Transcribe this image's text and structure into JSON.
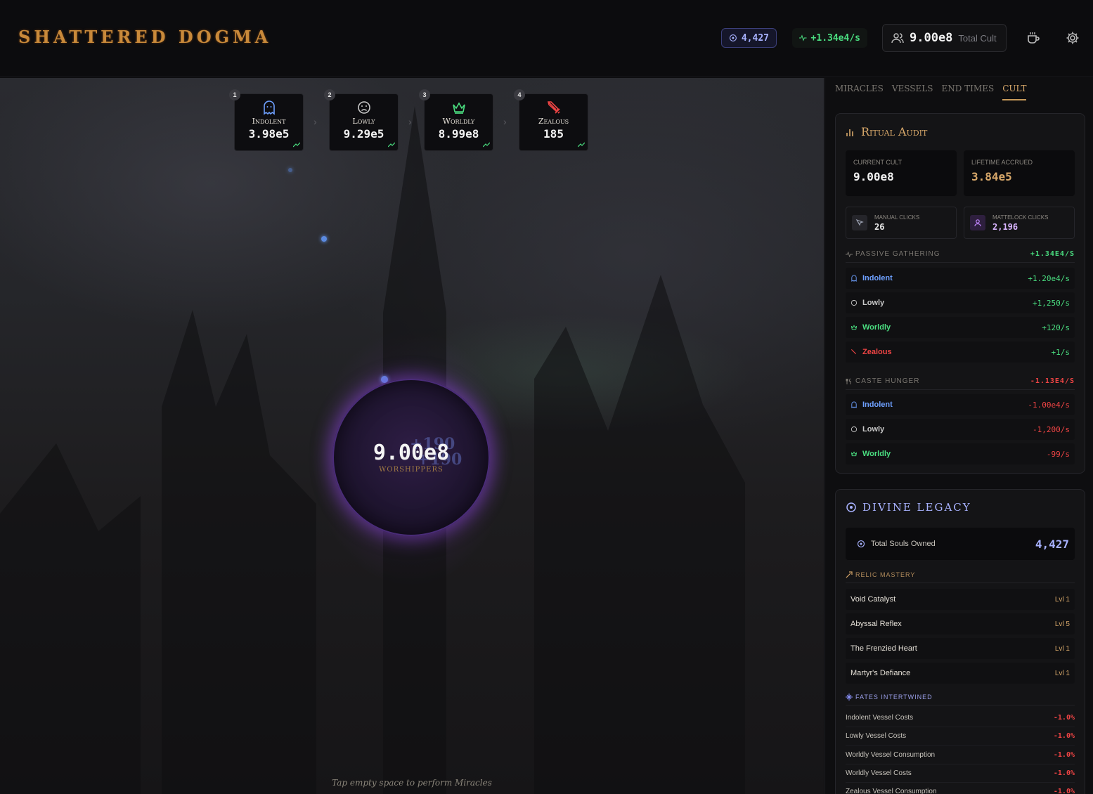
{
  "header": {
    "logo": "SHATTERED DOGMA",
    "souls": "4,427",
    "rate": "+1.34e4/s",
    "total_cult_value": "9.00e8",
    "total_cult_label": "Total Cult"
  },
  "castes": [
    {
      "num": "1",
      "name": "Indolent",
      "value": "3.98e5",
      "color": "#6ea0ff",
      "icon": "ghost-icon"
    },
    {
      "num": "2",
      "name": "Lowly",
      "value": "9.29e5",
      "color": "#b8b8b8",
      "icon": "frown-icon"
    },
    {
      "num": "3",
      "name": "Worldly",
      "value": "8.99e8",
      "color": "#4ade80",
      "icon": "crown-icon"
    },
    {
      "num": "4",
      "name": "Zealous",
      "value": "185",
      "color": "#ef4444",
      "icon": "sword-icon"
    }
  ],
  "orb": {
    "value": "9.00e8",
    "label": "WORSHIPPERS",
    "ghost_a": "+190",
    "ghost_b": "+190"
  },
  "hint": "Tap empty space to perform Miracles",
  "tabs": [
    "MIRACLES",
    "VESSELS",
    "END TIMES",
    "CULT"
  ],
  "active_tab": "CULT",
  "ritual_audit": {
    "title": "Ritual Audit",
    "current_cult_label": "CURRENT CULT",
    "current_cult_value": "9.00e8",
    "lifetime_label": "LIFETIME ACCRUED",
    "lifetime_value": "3.84e5",
    "manual_clicks_label": "MANUAL CLICKS",
    "manual_clicks_value": "26",
    "mattelock_label": "MATTELOCK CLICKS",
    "mattelock_value": "2,196",
    "passive_label": "PASSIVE GATHERING",
    "passive_total": "+1.34E4/S",
    "passive_rows": [
      {
        "name": "Indolent",
        "value": "+1.20e4/s"
      },
      {
        "name": "Lowly",
        "value": "+1,250/s"
      },
      {
        "name": "Worldly",
        "value": "+120/s"
      },
      {
        "name": "Zealous",
        "value": "+1/s"
      }
    ],
    "hunger_label": "CASTE HUNGER",
    "hunger_total": "-1.13E4/S",
    "hunger_rows": [
      {
        "name": "Indolent",
        "value": "-1.00e4/s"
      },
      {
        "name": "Lowly",
        "value": "-1,200/s"
      },
      {
        "name": "Worldly",
        "value": "-99/s"
      }
    ]
  },
  "divine_legacy": {
    "title": "DIVINE LEGACY",
    "owned_label": "Total Souls Owned",
    "owned_value": "4,427",
    "relic_label": "RELIC MASTERY",
    "relics": [
      {
        "name": "Void Catalyst",
        "level": "Lvl 1"
      },
      {
        "name": "Abyssal Reflex",
        "level": "Lvl 5"
      },
      {
        "name": "The Frenzied Heart",
        "level": "Lvl 1"
      },
      {
        "name": "Martyr's Defiance",
        "level": "Lvl 1"
      }
    ],
    "fates_label": "FATES INTERTWINED",
    "fates": [
      {
        "name": "Indolent Vessel Costs",
        "value": "-1.0%"
      },
      {
        "name": "Lowly Vessel Costs",
        "value": "-1.0%"
      },
      {
        "name": "Worldly Vessel Consumption",
        "value": "-1.0%"
      },
      {
        "name": "Worldly Vessel Costs",
        "value": "-1.0%"
      },
      {
        "name": "Zealous Vessel Consumption",
        "value": "-1.0%"
      }
    ]
  },
  "colors": {
    "accent_gold": "#c8893a",
    "souls_blue": "#a8b2ff",
    "positive": "#4ade80",
    "negative": "#ef4444"
  }
}
